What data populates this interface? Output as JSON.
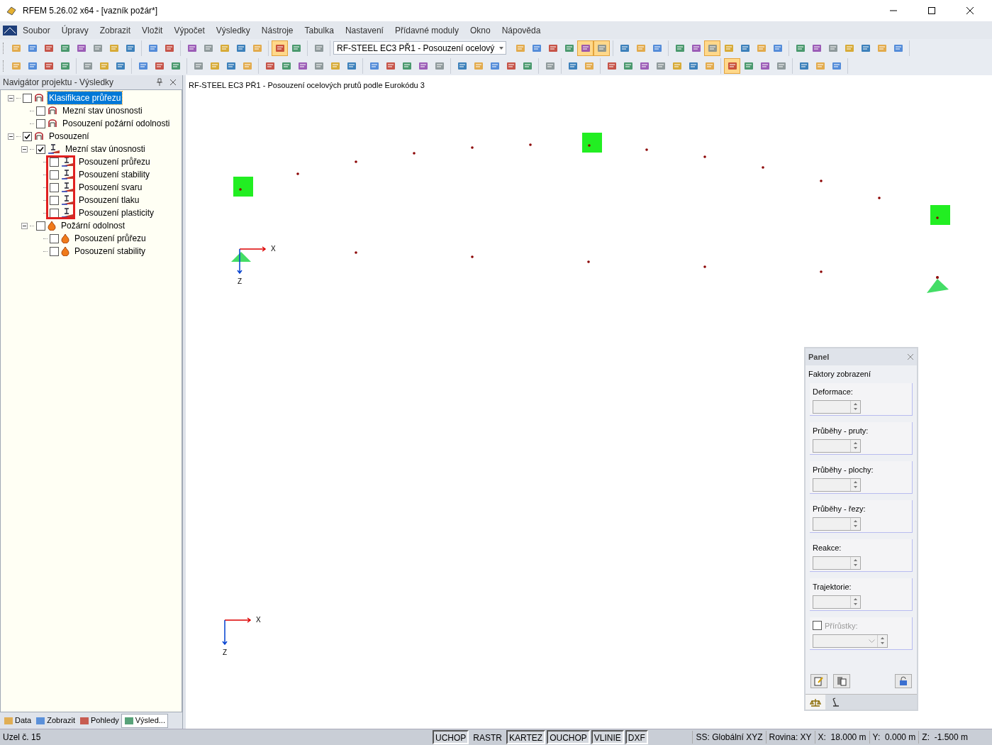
{
  "window": {
    "title": "RFEM 5.26.02 x64 - [vazník požár*]"
  },
  "menu": [
    "Soubor",
    "Úpravy",
    "Zobrazit",
    "Vložit",
    "Výpočet",
    "Výsledky",
    "Nástroje",
    "Tabulka",
    "Nastavení",
    "Přídavné moduly",
    "Okno",
    "Nápověda"
  ],
  "toolbar_1": {
    "groups_before": [
      [
        {
          "selected": false
        },
        {
          "selected": false
        },
        {
          "selected": false
        },
        {
          "selected": false
        },
        {
          "selected": false
        },
        {
          "selected": false
        },
        {
          "selected": false
        },
        {
          "selected": false
        }
      ],
      [
        {
          "selected": false
        },
        {
          "selected": false
        }
      ],
      [
        {
          "selected": false
        },
        {
          "selected": false
        },
        {
          "selected": false
        },
        {
          "selected": false
        },
        {
          "selected": false
        }
      ],
      [
        {
          "selected": true
        },
        {
          "selected": false
        }
      ],
      [
        {
          "selected": false
        }
      ]
    ],
    "combo": "RF-STEEL EC3 PŘ1 - Posouzení ocelový",
    "groups_after": [
      [
        {
          "selected": false
        },
        {
          "selected": false
        },
        {
          "selected": false
        },
        {
          "selected": false
        },
        {
          "selected": true
        },
        {
          "selected": true
        }
      ],
      [
        {
          "selected": false
        },
        {
          "selected": false
        },
        {
          "selected": false
        }
      ],
      [
        {
          "selected": false
        },
        {
          "selected": false
        },
        {
          "selected": true
        },
        {
          "selected": false
        },
        {
          "selected": false
        },
        {
          "selected": false
        },
        {
          "selected": false
        }
      ],
      [
        {
          "selected": false
        },
        {
          "selected": false
        },
        {
          "selected": false
        },
        {
          "selected": false
        },
        {
          "selected": false
        },
        {
          "selected": false
        },
        {
          "selected": false
        }
      ]
    ]
  },
  "toolbar_2": {
    "groups": [
      [
        {
          "selected": false
        },
        {
          "selected": false
        },
        {
          "selected": false
        },
        {
          "selected": false
        }
      ],
      [
        {
          "selected": false
        },
        {
          "selected": false
        },
        {
          "selected": false
        }
      ],
      [
        {
          "selected": false
        },
        {
          "selected": false
        },
        {
          "selected": false
        }
      ],
      [
        {
          "selected": false
        },
        {
          "selected": false
        },
        {
          "selected": false
        },
        {
          "selected": false
        }
      ],
      [
        {
          "selected": false
        },
        {
          "selected": false
        },
        {
          "selected": false
        },
        {
          "selected": false
        },
        {
          "selected": false
        },
        {
          "selected": false
        }
      ],
      [
        {
          "selected": false
        },
        {
          "selected": false
        },
        {
          "selected": false
        },
        {
          "selected": false
        },
        {
          "selected": false
        }
      ],
      [
        {
          "selected": false
        },
        {
          "selected": false
        },
        {
          "selected": false
        },
        {
          "selected": false
        },
        {
          "selected": false
        }
      ],
      [
        {
          "selected": false
        }
      ],
      [
        {
          "selected": false
        },
        {
          "selected": false
        }
      ],
      [
        {
          "selected": false
        },
        {
          "selected": false
        },
        {
          "selected": false
        },
        {
          "selected": false
        },
        {
          "selected": false
        },
        {
          "selected": false
        },
        {
          "selected": false
        }
      ],
      [
        {
          "selected": true
        },
        {
          "selected": false
        },
        {
          "selected": false
        },
        {
          "selected": false
        }
      ],
      [
        {
          "selected": false
        },
        {
          "selected": false
        },
        {
          "selected": false
        }
      ]
    ]
  },
  "navigator": {
    "title": "Navigátor projektu - Výsledky",
    "tree": [
      {
        "label": "Klasifikace průřezu",
        "kind": "section",
        "checked": false,
        "selected": true,
        "expanded": true,
        "highlighted": false,
        "children": [
          {
            "label": "Mezní stav únosnosti",
            "kind": "section",
            "checked": false,
            "selected": false
          },
          {
            "label": "Posouzení požární odolnosti",
            "kind": "section",
            "checked": false,
            "selected": false
          }
        ]
      },
      {
        "label": "Posouzení",
        "kind": "section",
        "checked": true,
        "selected": false,
        "expanded": true,
        "highlighted": false,
        "children": [
          {
            "label": "Mezní stav únosnosti",
            "kind": "beam",
            "checked": true,
            "selected": false,
            "expanded": true,
            "highlighted": true,
            "children": [
              {
                "label": "Posouzení průřezu",
                "kind": "beam",
                "checked": false,
                "selected": false
              },
              {
                "label": "Posouzení stability",
                "kind": "beam",
                "checked": false,
                "selected": false
              },
              {
                "label": "Posouzení svaru",
                "kind": "beam",
                "checked": false,
                "selected": false
              },
              {
                "label": "Posouzení tlaku",
                "kind": "beam",
                "checked": false,
                "selected": false
              },
              {
                "label": "Posouzení plasticity",
                "kind": "beam",
                "checked": false,
                "selected": false
              }
            ]
          },
          {
            "label": "Požární odolnost",
            "kind": "fire",
            "checked": false,
            "selected": false,
            "expanded": true,
            "highlighted": false,
            "children": [
              {
                "label": "Posouzení průřezu",
                "kind": "fire",
                "checked": false,
                "selected": false
              },
              {
                "label": "Posouzení stability",
                "kind": "fire",
                "checked": false,
                "selected": false
              }
            ]
          }
        ]
      }
    ],
    "tabs": [
      {
        "label": "Data",
        "selected": false
      },
      {
        "label": "Zobrazit",
        "selected": false
      },
      {
        "label": "Pohledy",
        "selected": false
      },
      {
        "label": "Výsled...",
        "selected": true
      }
    ]
  },
  "viewport": {
    "title": "RF-STEEL EC3 PŘ1 - Posouzení ocelových prutů podle Eurokódu 3",
    "axes": [
      {
        "x": "X",
        "z": "Z"
      },
      {
        "x": "X",
        "z": "Z"
      }
    ]
  },
  "panel": {
    "title": "Panel",
    "heading": "Faktory zobrazení",
    "fields": [
      {
        "label": "Deformace:",
        "kind": "spin"
      },
      {
        "label": "Průběhy - pruty:",
        "kind": "spin"
      },
      {
        "label": "Průběhy - plochy:",
        "kind": "spin"
      },
      {
        "label": "Průběhy - řezy:",
        "kind": "spin"
      },
      {
        "label": "Reakce:",
        "kind": "spin"
      },
      {
        "label": "Trajektorie:",
        "kind": "spin"
      },
      {
        "label": "Přírůstky:",
        "kind": "combo",
        "checked": false
      }
    ],
    "tabs": [
      {
        "selected": true
      },
      {
        "selected": false
      }
    ]
  },
  "status_bar": {
    "text": "Uzel č. 15",
    "toggles": [
      {
        "label": "UCHOP",
        "selected": true
      },
      {
        "label": "RASTR",
        "selected": false
      },
      {
        "label": "KARTEZ",
        "selected": true
      },
      {
        "label": "OUCHOP",
        "selected": true
      },
      {
        "label": "VLINIE",
        "selected": true
      },
      {
        "label": "DXF",
        "selected": true
      }
    ],
    "fields": [
      "SS: Globální XYZ",
      "Rovina: XY",
      "X:  18.000 m",
      "Y:  0.000 m",
      "Z:  -1.500 m"
    ]
  }
}
